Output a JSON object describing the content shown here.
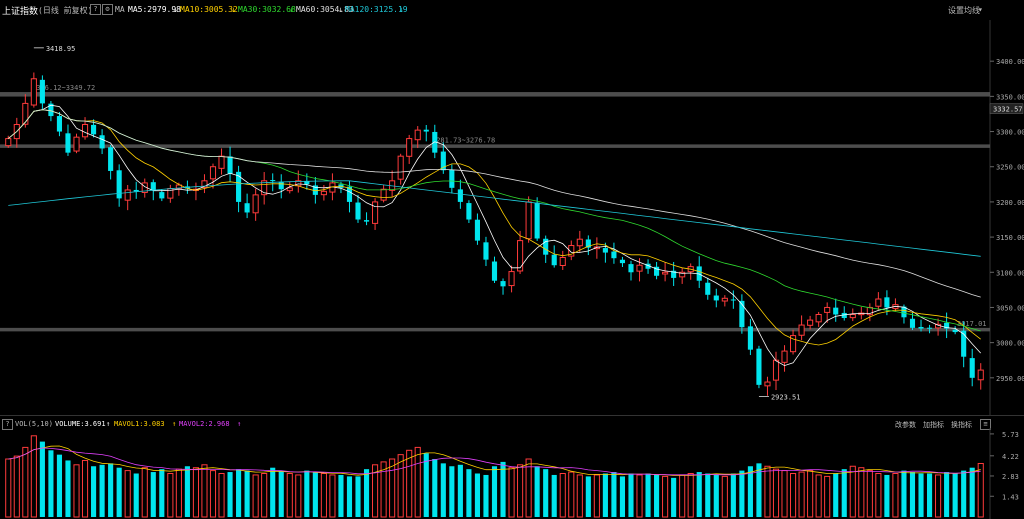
{
  "header": {
    "index_name": "上证指数",
    "period_mode": "(日线 前复权)",
    "ma_label": "MA",
    "ma5": "MA5:2979.98",
    "ma10": "MA10:3005.32",
    "ma30": "MA30:3032.68",
    "ma60": "MA60:3054.83",
    "ma120": "MA120:3125.19",
    "settings_label": "设置均线"
  },
  "volume_header": {
    "indicator": "VOL(5,10)",
    "volume": "VOLUME:3.691",
    "mavol1": "MAVOL1:3.083",
    "mavol2": "MAVOL2:2.968",
    "params_label": "改参数",
    "add_label": "加指标",
    "switch_label": "换指标"
  },
  "colors": {
    "up": "#ff3b3b",
    "down": "#00e5ee",
    "ma5": "#ffffff",
    "ma10": "#ffd000",
    "ma30": "#2fd92f",
    "ma60": "#e0e0e0",
    "ma120": "#1fc8d8",
    "mavol1": "#ffd000",
    "mavol2": "#e040fb"
  },
  "chart_data": [
    {
      "type": "candlestick",
      "ylim": [
        2900,
        3450
      ],
      "y_ticks": [
        "3400.00",
        "3350.00",
        "3300.00",
        "3250.00",
        "3200.00",
        "3150.00",
        "3100.00",
        "3050.00",
        "3000.00",
        "2950.00"
      ],
      "current_price_label": "3332.57",
      "annotations": {
        "high": "3418.95",
        "low": "2923.51",
        "zone1": "3356.12~3349.72",
        "zone2": "3281.73~3276.78",
        "zone3": "3017.01"
      },
      "close": [
        3290,
        3310,
        3340,
        3375,
        3340,
        3322,
        3300,
        3270,
        3292,
        3310,
        3296,
        3276,
        3244,
        3205,
        3217,
        3215,
        3227,
        3216,
        3205,
        3219,
        3224,
        3219,
        3218,
        3230,
        3250,
        3265,
        3240,
        3200,
        3185,
        3210,
        3230,
        3230,
        3218,
        3220,
        3230,
        3225,
        3210,
        3215,
        3227,
        3220,
        3200,
        3175,
        3172,
        3200,
        3218,
        3230,
        3265,
        3290,
        3302,
        3300,
        3270,
        3245,
        3220,
        3200,
        3175,
        3145,
        3118,
        3088,
        3080,
        3101,
        3145,
        3200,
        3148,
        3125,
        3110,
        3121,
        3138,
        3147,
        3135,
        3136,
        3128,
        3120,
        3113,
        3100,
        3110,
        3105,
        3095,
        3100,
        3092,
        3100,
        3108,
        3088,
        3068,
        3060,
        3063,
        3060,
        3022,
        2990,
        2940,
        2944,
        2975,
        2988,
        3010,
        3025,
        3032,
        3040,
        3050,
        3040,
        3035,
        3040,
        3042,
        3050,
        3062,
        3050,
        3054,
        3036,
        3021,
        3020,
        3020,
        3026,
        3020,
        3015,
        2980,
        2950,
        2961
      ],
      "volume": [
        4.0,
        4.2,
        4.8,
        5.6,
        5.2,
        4.6,
        4.3,
        3.9,
        3.6,
        3.9,
        3.5,
        3.6,
        3.7,
        3.4,
        3.2,
        3.0,
        3.4,
        3.1,
        3.3,
        3.0,
        3.3,
        3.5,
        3.4,
        3.6,
        3.2,
        3.0,
        3.1,
        3.3,
        3.2,
        2.9,
        3.0,
        3.4,
        3.2,
        3.0,
        2.9,
        3.2,
        3.1,
        3.0,
        2.9,
        2.9,
        2.8,
        2.8,
        3.3,
        3.6,
        3.8,
        4.0,
        4.3,
        4.6,
        4.8,
        4.4,
        4.0,
        3.7,
        3.5,
        3.6,
        3.3,
        3.0,
        2.9,
        3.5,
        3.8,
        3.4,
        3.6,
        4.0,
        3.5,
        3.3,
        2.9,
        3.0,
        3.1,
        2.9,
        2.8,
        2.9,
        3.0,
        3.1,
        2.8,
        3.0,
        2.9,
        3.0,
        2.9,
        2.8,
        2.7,
        2.9,
        3.0,
        3.1,
        3.0,
        2.9,
        2.8,
        3.0,
        3.2,
        3.5,
        3.7,
        3.5,
        3.3,
        3.2,
        3.0,
        3.1,
        3.2,
        2.9,
        2.8,
        3.0,
        3.3,
        3.5,
        3.4,
        3.2,
        3.0,
        2.9,
        3.0,
        3.2,
        3.1,
        3.0,
        3.0,
        2.9,
        3.1,
        3.0,
        3.2,
        3.4,
        3.69
      ],
      "volume_ticks": [
        "5.73",
        "4.22",
        "2.83",
        "1.43"
      ]
    }
  ]
}
